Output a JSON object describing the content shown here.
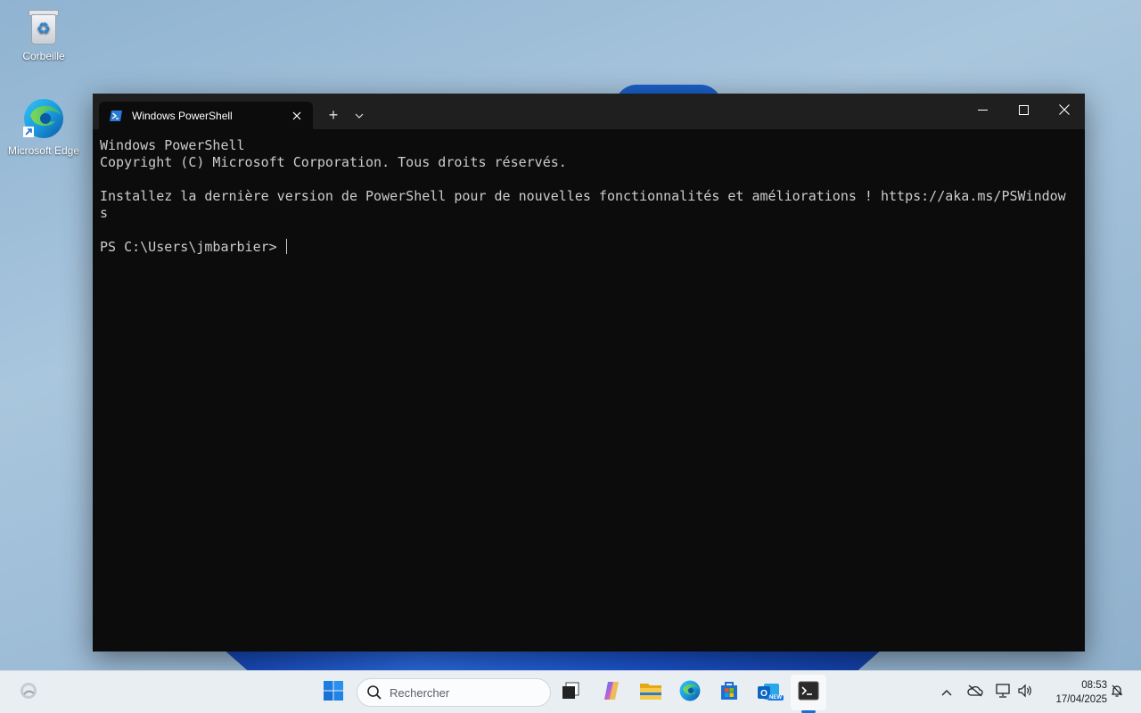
{
  "desktop": {
    "icons": [
      {
        "label": "Corbeille",
        "icon": "recycle-bin-icon"
      },
      {
        "label": "Microsoft Edge",
        "icon": "edge-icon"
      }
    ]
  },
  "terminal": {
    "tab_title": "Windows PowerShell",
    "tab_icon": "powershell-icon",
    "new_tab": "+",
    "console_lines": [
      "Windows PowerShell",
      "Copyright (C) Microsoft Corporation. Tous droits réservés.",
      "",
      "Installez la dernière version de PowerShell pour de nouvelles fonctionnalités et améliorations ! https://aka.ms/PSWindow",
      "s",
      ""
    ],
    "prompt": "PS C:\\Users\\jmbarbier> ",
    "colors": {
      "background": "#0c0c0c",
      "titlebar": "#1f1f1f",
      "text": "#cccccc"
    }
  },
  "taskbar": {
    "search_placeholder": "Rechercher",
    "apps": [
      "start-icon",
      "task-view-icon",
      "copilot-icon",
      "file-explorer-icon",
      "edge-icon",
      "store-icon",
      "outlook-icon",
      "terminal-icon"
    ],
    "outlook_badge": "NEW",
    "clock_time": "08:53",
    "clock_date": "17/04/2025",
    "accent": "#1a6fd6"
  }
}
